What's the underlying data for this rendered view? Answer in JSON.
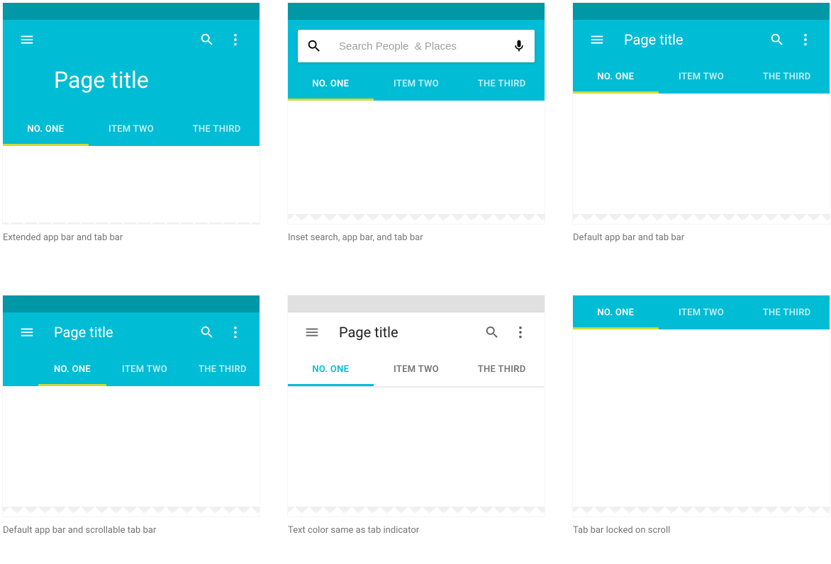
{
  "shared": {
    "page_title": "Page title",
    "tabs": [
      "NO. ONE",
      "ITEM TWO",
      "THE THIRD"
    ],
    "active_tab_index": 0
  },
  "search": {
    "placeholder": "Search People  & Places"
  },
  "examples": [
    {
      "id": "extended",
      "caption": "Extended app bar and tab bar"
    },
    {
      "id": "inset",
      "caption": "Inset search, app bar, and tab bar"
    },
    {
      "id": "default",
      "caption": "Default app bar and tab bar"
    },
    {
      "id": "scrollable",
      "caption": "Default app bar and scrollable tab bar"
    },
    {
      "id": "textcolor",
      "caption": "Text color same as tab indicator"
    },
    {
      "id": "locked",
      "caption": "Tab bar locked on scroll"
    }
  ],
  "colors": {
    "primary": "#00bcd4",
    "primary_dark": "#0097a7",
    "accent": "#cddc39"
  }
}
